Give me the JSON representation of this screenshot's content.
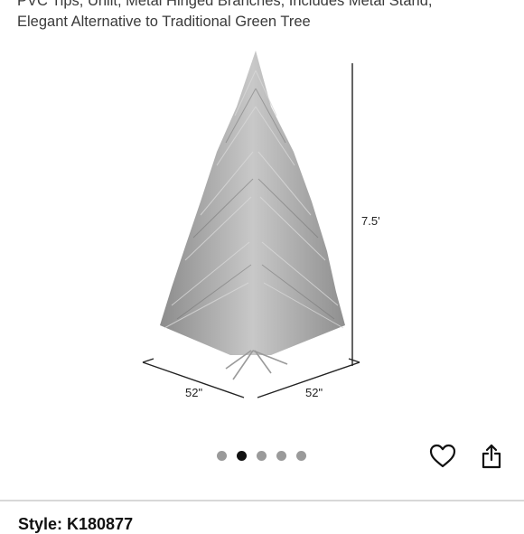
{
  "product": {
    "title_line_1": "PVC Tips, Unlit, Metal Hinged Branches, Includes Metal Stand,",
    "title_line_2": "Elegant Alternative to Traditional Green Tree"
  },
  "image": {
    "height_label": "7.5'",
    "width_label_left": "52\"",
    "width_label_right": "52\"",
    "carousel_total": 5,
    "carousel_active": 2
  },
  "actions": {
    "favorite_icon": "heart-icon",
    "share_icon": "share-icon"
  },
  "bottom": {
    "partial_text": "Style: K180877"
  },
  "colors": {
    "active_dot": "#111111",
    "inactive_dot": "#9a9a9a",
    "tree_silver": "#a9a9a9"
  }
}
